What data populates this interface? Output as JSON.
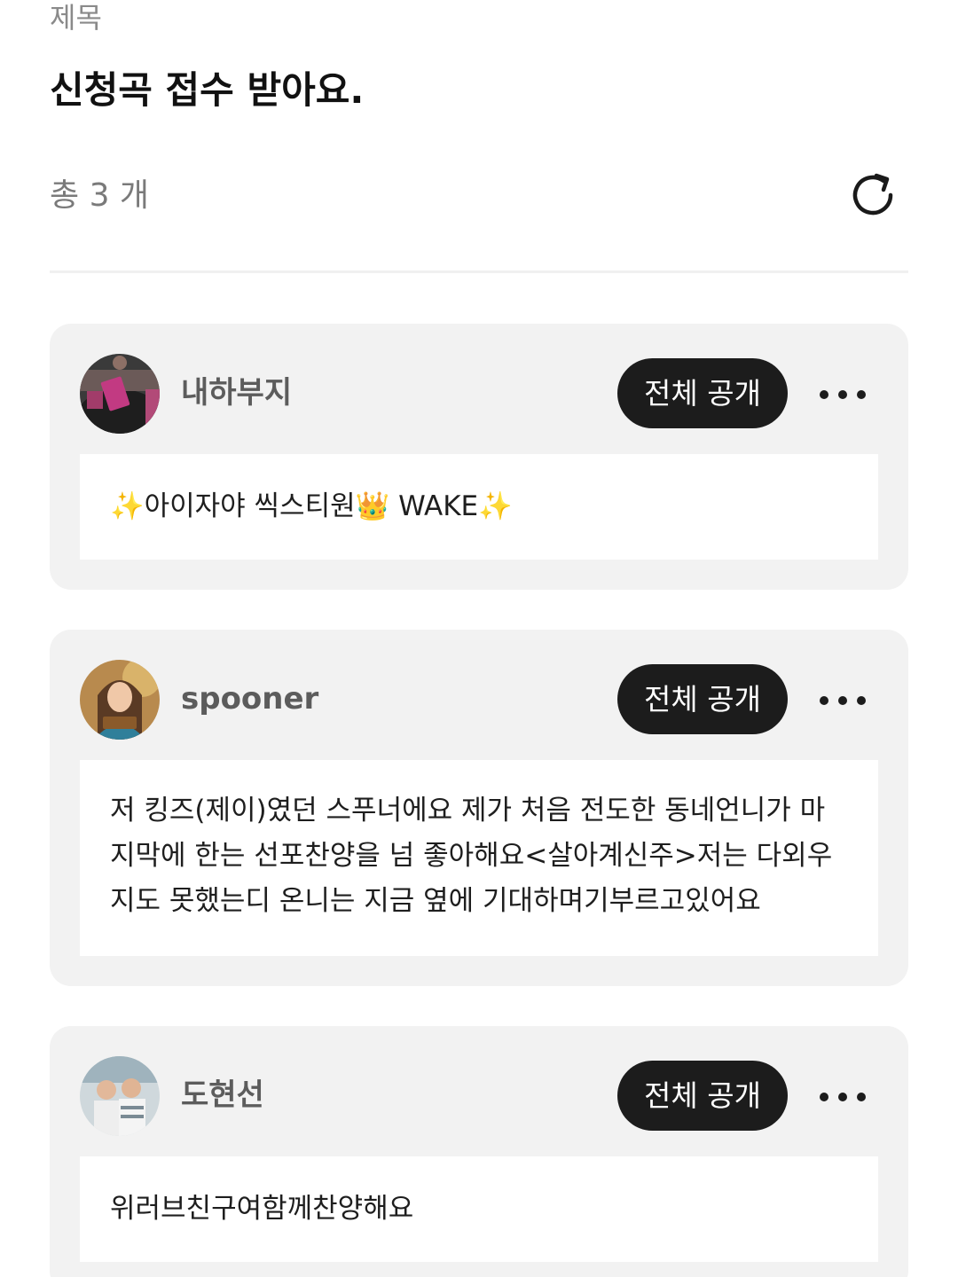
{
  "header": {
    "field_label": "제목",
    "title": "신청곡 접수 받아요.",
    "count_text": "총 3 개"
  },
  "icons": {
    "refresh": "refresh-icon",
    "more": "more-horizontal-icon"
  },
  "colors": {
    "card_bg": "#f2f2f2",
    "button_bg": "#1c1c1c",
    "button_text": "#ffffff",
    "username": "#5c5c5c",
    "muted": "#7a7a7a"
  },
  "posts": [
    {
      "username": "내하부지",
      "visibility_label": "전체 공개",
      "content": "✨아이자야 씩스티원👑 WAKE✨"
    },
    {
      "username": "spooner",
      "visibility_label": "전체 공개",
      "content": "저 킹즈(제이)였던 스푸너에요 제가 처음 전도한 동네언니가 마지막에 한는 선포찬양을 넘 좋아해요<살아계신주>저는 다외우지도 못했는디 온니는 지금 옆에 기대하며기부르고있어요"
    },
    {
      "username": "도현선",
      "visibility_label": "전체 공개",
      "content": "위러브친구여함께찬양해요"
    }
  ]
}
